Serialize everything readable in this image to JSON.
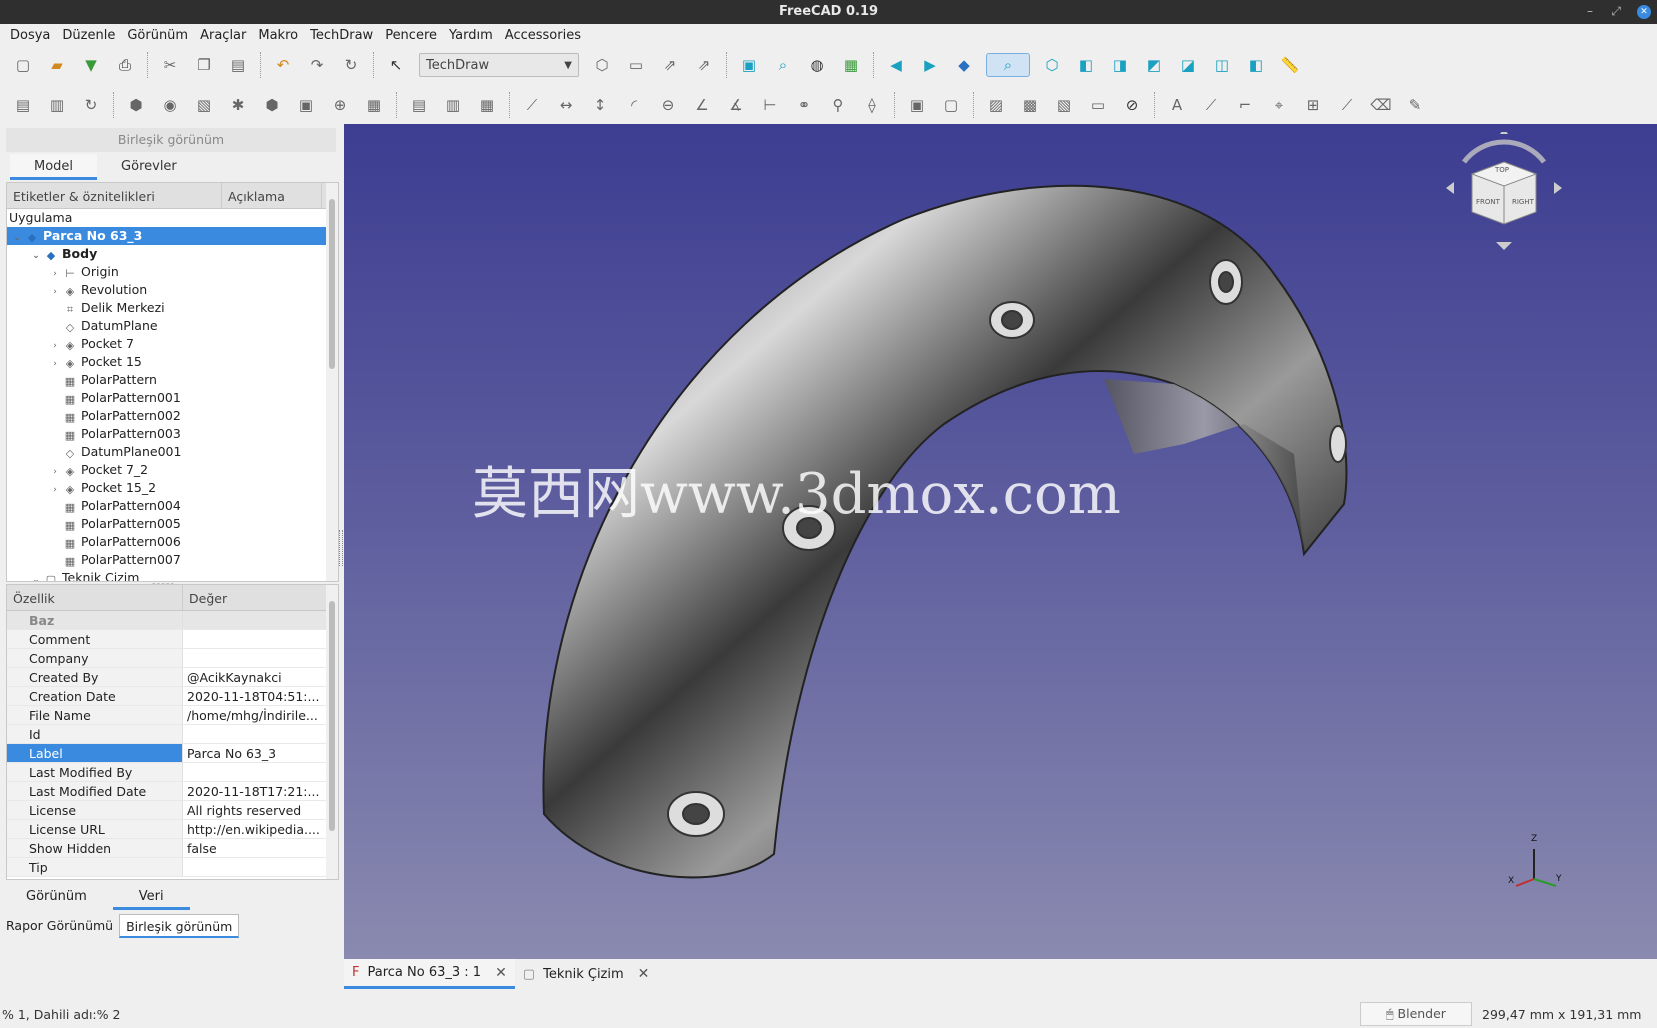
{
  "window": {
    "title": "FreeCAD 0.19"
  },
  "menu": [
    {
      "label": "Dosya"
    },
    {
      "label": "Düzenle"
    },
    {
      "label": "Görünüm"
    },
    {
      "label": "Araçlar"
    },
    {
      "label": "Makro"
    },
    {
      "label": "TechDraw"
    },
    {
      "label": "Pencere"
    },
    {
      "label": "Yardım"
    },
    {
      "label": "Accessories"
    }
  ],
  "toolbar": {
    "workbench": "TechDraw"
  },
  "combo": {
    "title": "Birleşik görünüm",
    "tabs": [
      "Model",
      "Görevler"
    ]
  },
  "tree": {
    "headers": [
      "Etiketler & öznitelikleri",
      "Açıklama"
    ],
    "section": "Uygulama",
    "items": [
      {
        "label": "Parca No 63_3",
        "level": 0,
        "exp": "v",
        "icon": "part-icon",
        "sel": true
      },
      {
        "label": "Body",
        "level": 1,
        "exp": "v",
        "icon": "body-icon",
        "bold": true
      },
      {
        "label": "Origin",
        "level": 2,
        "exp": ">",
        "icon": "origin-icon"
      },
      {
        "label": "Revolution",
        "level": 2,
        "exp": ">",
        "icon": "revolution-icon"
      },
      {
        "label": "Delik Merkezi",
        "level": 2,
        "exp": "",
        "icon": "sketch-icon"
      },
      {
        "label": "DatumPlane",
        "level": 2,
        "exp": "",
        "icon": "datum-plane-icon"
      },
      {
        "label": "Pocket 7",
        "level": 2,
        "exp": ">",
        "icon": "pocket-icon"
      },
      {
        "label": "Pocket 15",
        "level": 2,
        "exp": ">",
        "icon": "pocket-icon"
      },
      {
        "label": "PolarPattern",
        "level": 2,
        "exp": "",
        "icon": "polar-pattern-icon"
      },
      {
        "label": "PolarPattern001",
        "level": 2,
        "exp": "",
        "icon": "polar-pattern-icon"
      },
      {
        "label": "PolarPattern002",
        "level": 2,
        "exp": "",
        "icon": "polar-pattern-icon"
      },
      {
        "label": "PolarPattern003",
        "level": 2,
        "exp": "",
        "icon": "polar-pattern-icon"
      },
      {
        "label": "DatumPlane001",
        "level": 2,
        "exp": "",
        "icon": "datum-plane-icon"
      },
      {
        "label": "Pocket 7_2",
        "level": 2,
        "exp": ">",
        "icon": "pocket-icon"
      },
      {
        "label": "Pocket 15_2",
        "level": 2,
        "exp": ">",
        "icon": "pocket-icon"
      },
      {
        "label": "PolarPattern004",
        "level": 2,
        "exp": "",
        "icon": "polar-pattern-icon"
      },
      {
        "label": "PolarPattern005",
        "level": 2,
        "exp": "",
        "icon": "polar-pattern-icon"
      },
      {
        "label": "PolarPattern006",
        "level": 2,
        "exp": "",
        "icon": "polar-pattern-icon"
      },
      {
        "label": "PolarPattern007",
        "level": 2,
        "exp": "",
        "icon": "polar-pattern-icon"
      },
      {
        "label": "Teknik Çizim",
        "level": 1,
        "exp": "v",
        "icon": "page-icon"
      }
    ]
  },
  "props": {
    "headers": [
      "Özellik",
      "Değer"
    ],
    "group": "Baz",
    "rows": [
      {
        "k": "Comment",
        "v": ""
      },
      {
        "k": "Company",
        "v": ""
      },
      {
        "k": "Created By",
        "v": "@AcikKaynakci"
      },
      {
        "k": "Creation Date",
        "v": "2020-11-18T04:51:..."
      },
      {
        "k": "File Name",
        "v": "/home/mhg/İndirile..."
      },
      {
        "k": "Id",
        "v": ""
      },
      {
        "k": "Label",
        "v": "Parca No 63_3",
        "sel": true
      },
      {
        "k": "Last Modified By",
        "v": ""
      },
      {
        "k": "Last Modified Date",
        "v": "2020-11-18T17:21:..."
      },
      {
        "k": "License",
        "v": "All rights reserved"
      },
      {
        "k": "License URL",
        "v": "http://en.wikipedia...."
      },
      {
        "k": "Show Hidden",
        "v": "false"
      },
      {
        "k": "Tip",
        "v": ""
      }
    ]
  },
  "bottom_tabs": [
    "Görünüm",
    "Veri"
  ],
  "report_tabs": [
    "Rapor Görünümü",
    "Birleşik görünüm"
  ],
  "viewport": {
    "watermark": "莫西网www.3dmox.com",
    "cube": {
      "top": "TOP",
      "front": "FRONT",
      "right": "RIGHT"
    },
    "axes": {
      "x": "X",
      "y": "Y",
      "z": "Z"
    }
  },
  "doc_tabs": [
    {
      "label": "Parca No 63_3 : 1"
    },
    {
      "label": "Teknik Çizim"
    }
  ],
  "status": {
    "left": "% 1, Dahili adı:% 2",
    "nav": "Blender",
    "dims": "299,47 mm x 191,31 mm"
  },
  "colors": {
    "accent": "#3a8be0",
    "viewport_top": "#3d3d92",
    "viewport_bottom": "#8a8ab0"
  }
}
